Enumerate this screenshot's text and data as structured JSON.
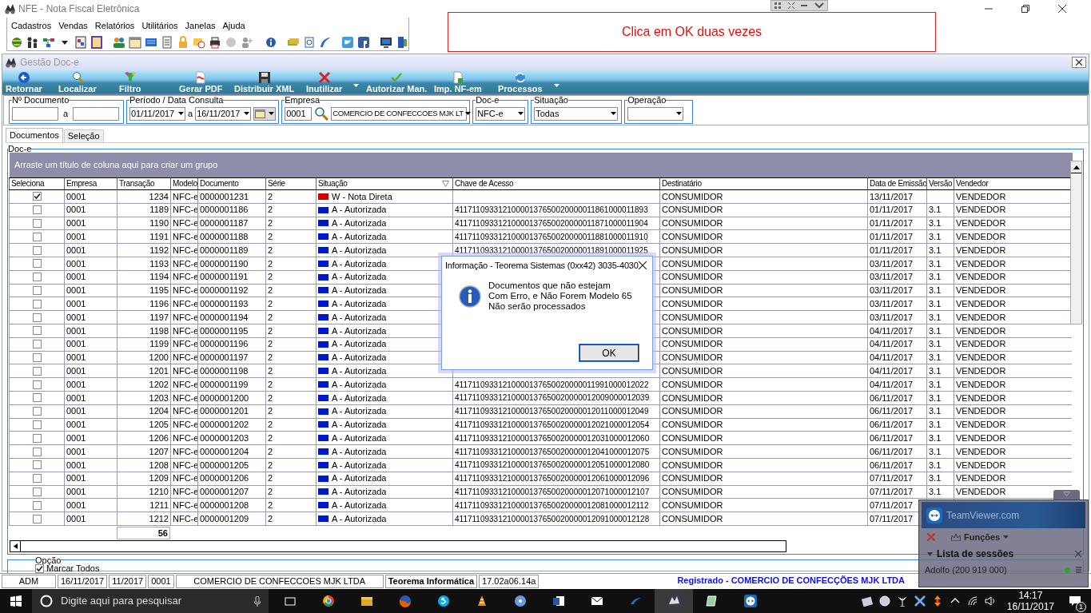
{
  "window": {
    "title": "NFE - Nota Fiscal Eletrônica"
  },
  "menu": [
    "Cadastros",
    "Vendas",
    "Relatórios",
    "Utilitários",
    "Janelas",
    "Ajuda"
  ],
  "annotation": {
    "text": "Clica em OK duas vezes"
  },
  "child_window": {
    "title": "Gestão Doc-e"
  },
  "toolbar": [
    {
      "kind": "back",
      "label": "Retornar",
      "dropdown": false
    },
    {
      "kind": "search",
      "label": "Localizar",
      "dropdown": false
    },
    {
      "kind": "filter",
      "label": "Filtro",
      "dropdown": false
    },
    {
      "kind": "pdf",
      "label": "Gerar PDF",
      "dropdown": false
    },
    {
      "kind": "save",
      "label": "Distribuir XML",
      "dropdown": false
    },
    {
      "kind": "cancel",
      "label": "Inutilizar",
      "dropdown": true
    },
    {
      "kind": "check",
      "label": "Autorizar Man.",
      "dropdown": false
    },
    {
      "kind": "doc",
      "label": "Imp. NF-em",
      "dropdown": false
    },
    {
      "kind": "process",
      "label": "Processos",
      "dropdown": true
    }
  ],
  "filters": {
    "documento": {
      "label": "Nº Documento",
      "between": "a"
    },
    "periodo": {
      "label": "Período / Data Consulta",
      "from": "01/11/2017",
      "between": "a",
      "to": "16/11/2017"
    },
    "empresa": {
      "label": "Empresa",
      "code": "0001",
      "name": "COMERCIO DE CONFECCOES MJK LT"
    },
    "doc_e": {
      "label": "Doc-e",
      "value": "NFC-e"
    },
    "situacao": {
      "label": "Situação",
      "value": "Todas"
    },
    "operacao": {
      "label": "Operação"
    }
  },
  "tabs": [
    {
      "label": "Documentos",
      "selected": true
    },
    {
      "label": "Seleção",
      "selected": false
    }
  ],
  "grid": {
    "label": "Doc-e",
    "group_hint": "Arraste um título de coluna aqui para criar um grupo",
    "columns": [
      {
        "label": "Seleciona",
        "filter": false
      },
      {
        "label": "Empresa",
        "filter": false
      },
      {
        "label": "Transação",
        "filter": false
      },
      {
        "label": "Modelo",
        "filter": false
      },
      {
        "label": "Documento",
        "filter": false
      },
      {
        "label": "Série",
        "filter": false
      },
      {
        "label": "Situação",
        "filter": true
      },
      {
        "label": "Chave de Acesso",
        "filter": false
      },
      {
        "label": "Destinatário",
        "filter": false
      },
      {
        "label": "Data de Emissão",
        "filter": false
      },
      {
        "label": "Versão",
        "filter": false
      },
      {
        "label": "Vendedor",
        "filter": false
      }
    ],
    "rows": [
      {
        "checked": true,
        "empresa": "0001",
        "transacao": "1234",
        "modelo": "NFC-e",
        "documento": "0000001231",
        "serie": "2",
        "situacao": "W - Nota Direta",
        "color": "#cc0000",
        "destinatario": "CONSUMIDOR",
        "data": "13/11/2017",
        "vendedor": "VENDEDOR"
      },
      {
        "checked": false,
        "empresa": "0001",
        "transacao": "1189",
        "modelo": "NFC-e",
        "documento": "0000001186",
        "serie": "2",
        "situacao": "A - Autorizada",
        "color": "#0018c8",
        "chave": "41171109331210000137650020000011861000011893",
        "destinatario": "CONSUMIDOR",
        "data": "01/11/2017",
        "versao": "3.1",
        "vendedor": "VENDEDOR"
      },
      {
        "checked": false,
        "empresa": "0001",
        "transacao": "1190",
        "modelo": "NFC-e",
        "documento": "0000001187",
        "serie": "2",
        "situacao": "A - Autorizada",
        "color": "#0018c8",
        "chave": "41171109331210000137650020000011871000011904",
        "destinatario": "CONSUMIDOR",
        "data": "01/11/2017",
        "versao": "3.1",
        "vendedor": "VENDEDOR"
      },
      {
        "checked": false,
        "empresa": "0001",
        "transacao": "1191",
        "modelo": "NFC-e",
        "documento": "0000001188",
        "serie": "2",
        "situacao": "A - Autorizada",
        "color": "#0018c8",
        "chave": "41171109331210000137650020000011881000011910",
        "destinatario": "CONSUMIDOR",
        "data": "01/11/2017",
        "versao": "3.1",
        "vendedor": "VENDEDOR"
      },
      {
        "checked": false,
        "empresa": "0001",
        "transacao": "1192",
        "modelo": "NFC-e",
        "documento": "0000001189",
        "serie": "2",
        "situacao": "A - Autorizada",
        "color": "#0018c8",
        "chave": "41171109331210000137650020000011891000011925",
        "destinatario": "CONSUMIDOR",
        "data": "01/11/2017",
        "versao": "3.1",
        "vendedor": "VENDEDOR"
      },
      {
        "checked": false,
        "empresa": "0001",
        "transacao": "1193",
        "modelo": "NFC-e",
        "documento": "0000001190",
        "serie": "2",
        "situacao": "A - Autorizada",
        "color": "#0018c8",
        "destinatario": "CONSUMIDOR",
        "data": "03/11/2017",
        "versao": "3.1",
        "vendedor": "VENDEDOR"
      },
      {
        "checked": false,
        "empresa": "0001",
        "transacao": "1194",
        "modelo": "NFC-e",
        "documento": "0000001191",
        "serie": "2",
        "situacao": "A - Autorizada",
        "color": "#0018c8",
        "destinatario": "CONSUMIDOR",
        "data": "03/11/2017",
        "versao": "3.1",
        "vendedor": "VENDEDOR"
      },
      {
        "checked": false,
        "empresa": "0001",
        "transacao": "1195",
        "modelo": "NFC-e",
        "documento": "0000001192",
        "serie": "2",
        "situacao": "A - Autorizada",
        "color": "#0018c8",
        "destinatario": "CONSUMIDOR",
        "data": "03/11/2017",
        "versao": "3.1",
        "vendedor": "VENDEDOR"
      },
      {
        "checked": false,
        "empresa": "0001",
        "transacao": "1196",
        "modelo": "NFC-e",
        "documento": "0000001193",
        "serie": "2",
        "situacao": "A - Autorizada",
        "color": "#0018c8",
        "destinatario": "CONSUMIDOR",
        "data": "03/11/2017",
        "versao": "3.1",
        "vendedor": "VENDEDOR"
      },
      {
        "checked": false,
        "empresa": "0001",
        "transacao": "1197",
        "modelo": "NFC-e",
        "documento": "0000001194",
        "serie": "2",
        "situacao": "A - Autorizada",
        "color": "#0018c8",
        "destinatario": "CONSUMIDOR",
        "data": "03/11/2017",
        "versao": "3.1",
        "vendedor": "VENDEDOR"
      },
      {
        "checked": false,
        "empresa": "0001",
        "transacao": "1198",
        "modelo": "NFC-e",
        "documento": "0000001195",
        "serie": "2",
        "situacao": "A - Autorizada",
        "color": "#0018c8",
        "destinatario": "CONSUMIDOR",
        "data": "04/11/2017",
        "versao": "3.1",
        "vendedor": "VENDEDOR"
      },
      {
        "checked": false,
        "empresa": "0001",
        "transacao": "1199",
        "modelo": "NFC-e",
        "documento": "0000001196",
        "serie": "2",
        "situacao": "A - Autorizada",
        "color": "#0018c8",
        "destinatario": "CONSUMIDOR",
        "data": "04/11/2017",
        "versao": "3.1",
        "vendedor": "VENDEDOR"
      },
      {
        "checked": false,
        "empresa": "0001",
        "transacao": "1200",
        "modelo": "NFC-e",
        "documento": "0000001197",
        "serie": "2",
        "situacao": "A - Autorizada",
        "color": "#0018c8",
        "destinatario": "CONSUMIDOR",
        "data": "04/11/2017",
        "versao": "3.1",
        "vendedor": "VENDEDOR"
      },
      {
        "checked": false,
        "empresa": "0001",
        "transacao": "1201",
        "modelo": "NFC-e",
        "documento": "0000001198",
        "serie": "2",
        "situacao": "A - Autorizada",
        "color": "#0018c8",
        "destinatario": "CONSUMIDOR",
        "data": "04/11/2017",
        "versao": "3.1",
        "vendedor": "VENDEDOR"
      },
      {
        "checked": false,
        "empresa": "0001",
        "transacao": "1202",
        "modelo": "NFC-e",
        "documento": "0000001199",
        "serie": "2",
        "situacao": "A - Autorizada",
        "color": "#0018c8",
        "chave": "41171109331210000137650020000011991000012022",
        "destinatario": "CONSUMIDOR",
        "data": "04/11/2017",
        "versao": "3.1",
        "vendedor": "VENDEDOR"
      },
      {
        "checked": false,
        "empresa": "0001",
        "transacao": "1203",
        "modelo": "NFC-e",
        "documento": "0000001200",
        "serie": "2",
        "situacao": "A - Autorizada",
        "color": "#0018c8",
        "chave": "41171109331210000137650020000012009000012039",
        "destinatario": "CONSUMIDOR",
        "data": "06/11/2017",
        "versao": "3.1",
        "vendedor": "VENDEDOR"
      },
      {
        "checked": false,
        "empresa": "0001",
        "transacao": "1204",
        "modelo": "NFC-e",
        "documento": "0000001201",
        "serie": "2",
        "situacao": "A - Autorizada",
        "color": "#0018c8",
        "chave": "41171109331210000137650020000012011000012049",
        "destinatario": "CONSUMIDOR",
        "data": "06/11/2017",
        "versao": "3.1",
        "vendedor": "VENDEDOR"
      },
      {
        "checked": false,
        "empresa": "0001",
        "transacao": "1205",
        "modelo": "NFC-e",
        "documento": "0000001202",
        "serie": "2",
        "situacao": "A - Autorizada",
        "color": "#0018c8",
        "chave": "41171109331210000137650020000012021000012054",
        "destinatario": "CONSUMIDOR",
        "data": "06/11/2017",
        "versao": "3.1",
        "vendedor": "VENDEDOR"
      },
      {
        "checked": false,
        "empresa": "0001",
        "transacao": "1206",
        "modelo": "NFC-e",
        "documento": "0000001203",
        "serie": "2",
        "situacao": "A - Autorizada",
        "color": "#0018c8",
        "chave": "41171109331210000137650020000012031000012060",
        "destinatario": "CONSUMIDOR",
        "data": "06/11/2017",
        "versao": "3.1",
        "vendedor": "VENDEDOR"
      },
      {
        "checked": false,
        "empresa": "0001",
        "transacao": "1207",
        "modelo": "NFC-e",
        "documento": "0000001204",
        "serie": "2",
        "situacao": "A - Autorizada",
        "color": "#0018c8",
        "chave": "41171109331210000137650020000012041000012075",
        "destinatario": "CONSUMIDOR",
        "data": "06/11/2017",
        "versao": "3.1",
        "vendedor": "VENDEDOR"
      },
      {
        "checked": false,
        "empresa": "0001",
        "transacao": "1208",
        "modelo": "NFC-e",
        "documento": "0000001205",
        "serie": "2",
        "situacao": "A - Autorizada",
        "color": "#0018c8",
        "chave": "41171109331210000137650020000012051000012080",
        "destinatario": "CONSUMIDOR",
        "data": "06/11/2017",
        "versao": "3.1",
        "vendedor": "VENDEDOR"
      },
      {
        "checked": false,
        "empresa": "0001",
        "transacao": "1209",
        "modelo": "NFC-e",
        "documento": "0000001206",
        "serie": "2",
        "situacao": "A - Autorizada",
        "color": "#0018c8",
        "chave": "41171109331210000137650020000012061000012096",
        "destinatario": "CONSUMIDOR",
        "data": "07/11/2017",
        "versao": "3.1",
        "vendedor": "VENDEDOR"
      },
      {
        "checked": false,
        "empresa": "0001",
        "transacao": "1210",
        "modelo": "NFC-e",
        "documento": "0000001207",
        "serie": "2",
        "situacao": "A - Autorizada",
        "color": "#0018c8",
        "chave": "41171109331210000137650020000012071000012107",
        "destinatario": "CONSUMIDOR",
        "data": "07/11/2017",
        "versao": "3.1",
        "vendedor": "VENDEDOR"
      },
      {
        "checked": false,
        "empresa": "0001",
        "transacao": "1211",
        "modelo": "NFC-e",
        "documento": "0000001208",
        "serie": "2",
        "situacao": "A - Autorizada",
        "color": "#0018c8",
        "chave": "41171109331210000137650020000012081000012112",
        "destinatario": "CONSUMIDOR",
        "data": "07/11/2017"
      },
      {
        "checked": false,
        "empresa": "0001",
        "transacao": "1212",
        "modelo": "NFC-e",
        "documento": "0000001209",
        "serie": "2",
        "situacao": "A - Autorizada",
        "color": "#0018c8",
        "chave": "41171109331210000137650020000012091000012128",
        "destinatario": "CONSUMIDOR",
        "data": "07/11/2017"
      }
    ],
    "total": "56"
  },
  "options": {
    "label": "Opção",
    "mark_all": {
      "label": "Marcar Todos",
      "checked": true
    }
  },
  "status_bar": [
    {
      "kind": "cell",
      "text": "ADM"
    },
    {
      "kind": "cell",
      "text": "16/11/2017"
    },
    {
      "kind": "cell",
      "text": "11/2017"
    },
    {
      "kind": "cell",
      "text": "0001"
    },
    {
      "kind": "cell",
      "text": "COMERCIO DE CONFECCOES MJK LTDA"
    },
    {
      "kind": "bold",
      "text": "Teorema Informática"
    },
    {
      "kind": "cell",
      "text": "17.02a06.14a"
    },
    {
      "kind": "registered",
      "text": "Registrado - COMERCIO DE CONFECÇÕES MJK LTDA"
    }
  ],
  "dialog": {
    "title": "Informação - Teorema Sistemas (0xx42) 3035-4030",
    "lines": [
      "Documentos que não estejam",
      "Com Erro, e Não Forem Modelo 65",
      "Não serão processados"
    ],
    "button": "OK"
  },
  "teamviewer": {
    "brand": "TeamViewer.com",
    "functions": "Funções",
    "sessions": "Lista de sessões",
    "session": "Adolfo (200 919 000)"
  },
  "taskbar": {
    "search": "Digite aqui para pesquisar",
    "time": "14:17",
    "date": "16/11/2017",
    "notifications": "1"
  }
}
